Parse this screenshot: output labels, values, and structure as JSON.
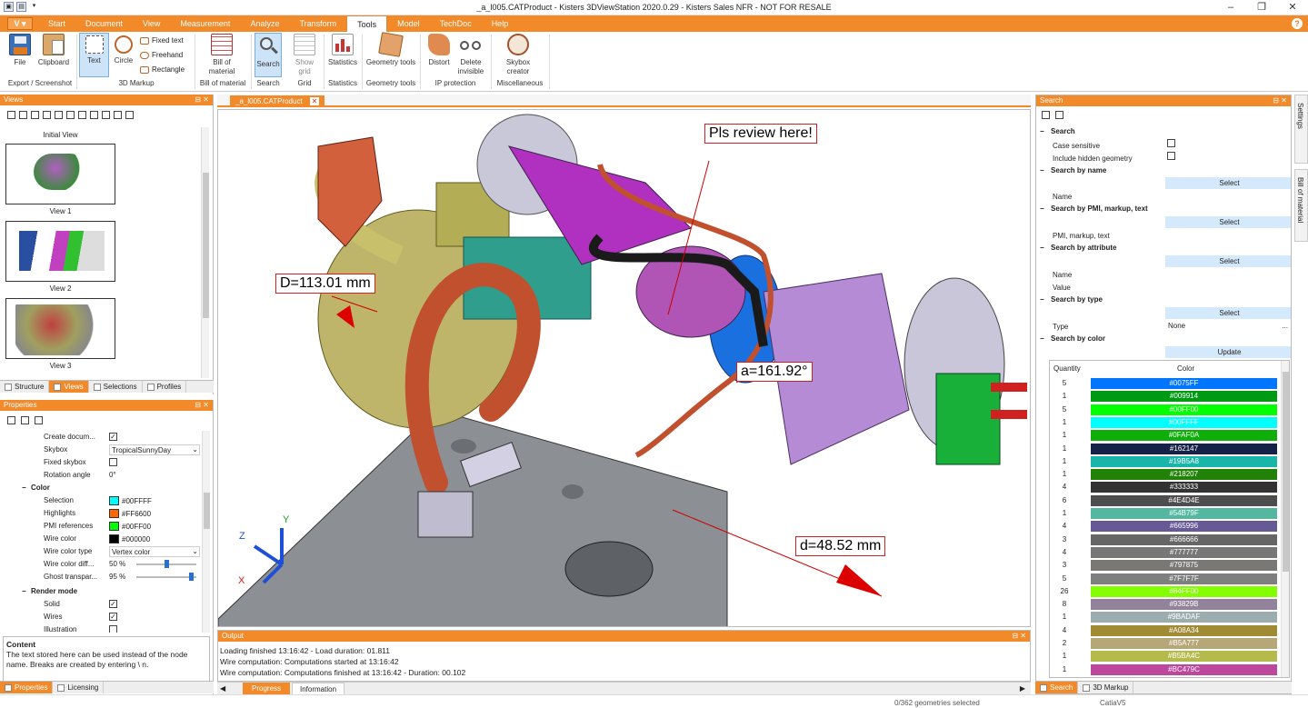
{
  "title": "_a_l005.CATProduct - Kisters 3DViewStation 2020.0.29 - Kisters Sales NFR - NOT FOR RESALE",
  "menu": {
    "logo": "V",
    "items": [
      "Start",
      "Document",
      "View",
      "Measurement",
      "Analyze",
      "Transform",
      "Tools",
      "Model",
      "TechDoc",
      "Help"
    ],
    "active": "Tools"
  },
  "ribbon": {
    "file": "File",
    "clipboard": "Clipboard",
    "text": "Text",
    "circle": "Circle",
    "fixed_text": "Fixed text",
    "freehand": "Freehand",
    "rectangle": "Rectangle",
    "bill_of_material": "Bill of material",
    "search": "Search",
    "show_grid": "Show grid",
    "statistics": "Statistics",
    "geometry_tools": "Geometry tools",
    "distort": "Distort",
    "delete_invisible": "Delete invisible",
    "skybox_creator": "Skybox creator",
    "groups": {
      "export": "Export / Screenshot",
      "markup": "3D Markup",
      "bom": "Bill of material",
      "search": "Search",
      "grid": "Grid",
      "statistics": "Statistics",
      "geometry": "Geometry tools",
      "ip": "IP protection",
      "misc": "Miscellaneous"
    }
  },
  "views_panel": {
    "title": "Views",
    "items": [
      "Initial View",
      "View 1",
      "View 2",
      "View 3"
    ],
    "tabs": [
      "Structure",
      "Views",
      "Selections",
      "Profiles"
    ],
    "active_tab": "Views"
  },
  "properties_panel": {
    "title": "Properties",
    "rows": [
      {
        "k": "Create docum...",
        "type": "check",
        "v": "✓"
      },
      {
        "k": "Skybox",
        "type": "select",
        "v": "TropicalSunnyDay"
      },
      {
        "k": "Fixed skybox",
        "type": "check",
        "v": ""
      },
      {
        "k": "Rotation angle",
        "type": "text",
        "v": "0°"
      }
    ],
    "color_group": "Color",
    "color_rows": [
      {
        "k": "Selection",
        "color": "#00FFFF",
        "v": "#00FFFF"
      },
      {
        "k": "Highlights",
        "color": "#FF6600",
        "v": "#FF6600"
      },
      {
        "k": "PMI references",
        "color": "#00FF00",
        "v": "#00FF00"
      },
      {
        "k": "Wire color",
        "color": "#000000",
        "v": "#000000"
      }
    ],
    "wire_color_type": {
      "k": "Wire color type",
      "v": "Vertex color"
    },
    "wire_diff": {
      "k": "Wire color diff...",
      "v": "50 %",
      "level": 0.5
    },
    "ghost": {
      "k": "Ghost transpar...",
      "v": "95 %",
      "level": 0.95
    },
    "render_group": "Render mode",
    "render_rows": [
      {
        "k": "Solid",
        "v": "✓"
      },
      {
        "k": "Wires",
        "v": "✓"
      },
      {
        "k": "Illustration",
        "v": ""
      }
    ],
    "content_title": "Content",
    "content_text": "The text stored here can be used instead of the node name. Breaks are created by entering \\ n.",
    "tabs": [
      "Properties",
      "Licensing"
    ]
  },
  "document_tab": "_a_l005.CATProduct",
  "callouts": {
    "review": "Pls review here!",
    "diameter": "D=113.01 mm",
    "angle": "a=161.92°",
    "distance": "d=48.52 mm"
  },
  "axes": {
    "x": "X",
    "y": "Y",
    "z": "Z"
  },
  "output": {
    "title": "Output",
    "lines": [
      "Loading finished 13:16:42 - Load duration: 01.811",
      "Wire computation: Computations started at 13:16:42",
      "Wire computation: Computations finished at 13:16:42 - Duration: 00.102"
    ],
    "tabs": [
      "Progress",
      "Information"
    ]
  },
  "search_panel": {
    "title": "Search",
    "search_hdr": "Search",
    "case_sensitive": "Case sensitive",
    "include_hidden": "Include hidden geometry",
    "by_name": "Search by name",
    "by_pmi": "Search by PMI, markup, text",
    "by_attribute": "Search by attribute",
    "by_type": "Search by type",
    "by_color": "Search by color",
    "select": "Select",
    "update": "Update",
    "name": "Name",
    "pmi": "PMI, markup, text",
    "value": "Value",
    "type": "Type",
    "type_value": "None",
    "col_quantity": "Quantity",
    "col_color": "Color",
    "colors": [
      {
        "q": "5",
        "c": "#0075FF"
      },
      {
        "q": "1",
        "c": "#009914"
      },
      {
        "q": "5",
        "c": "#00FF00"
      },
      {
        "q": "1",
        "c": "#00FFFF"
      },
      {
        "q": "1",
        "c": "#0FAF0A"
      },
      {
        "q": "1",
        "c": "#162147"
      },
      {
        "q": "1",
        "c": "#19B5A8"
      },
      {
        "q": "1",
        "c": "#218207"
      },
      {
        "q": "4",
        "c": "#333333"
      },
      {
        "q": "6",
        "c": "#4E4D4E"
      },
      {
        "q": "1",
        "c": "#54B79F"
      },
      {
        "q": "4",
        "c": "#665996"
      },
      {
        "q": "3",
        "c": "#666666"
      },
      {
        "q": "4",
        "c": "#777777"
      },
      {
        "q": "3",
        "c": "#797875"
      },
      {
        "q": "5",
        "c": "#7F7F7F"
      },
      {
        "q": "26",
        "c": "#84FF00"
      },
      {
        "q": "8",
        "c": "#93829B"
      },
      {
        "q": "1",
        "c": "#9BADAF"
      },
      {
        "q": "4",
        "c": "#A08A34"
      },
      {
        "q": "2",
        "c": "#B5A777"
      },
      {
        "q": "1",
        "c": "#B5BA4C"
      },
      {
        "q": "1",
        "c": "#BC479C"
      }
    ],
    "tabs": [
      "Search",
      "3D Markup"
    ],
    "side_tabs": [
      "Settings",
      "Bill of material"
    ]
  },
  "status": {
    "geometries": "0/362 geometries selected",
    "format": "CatiaV5"
  }
}
